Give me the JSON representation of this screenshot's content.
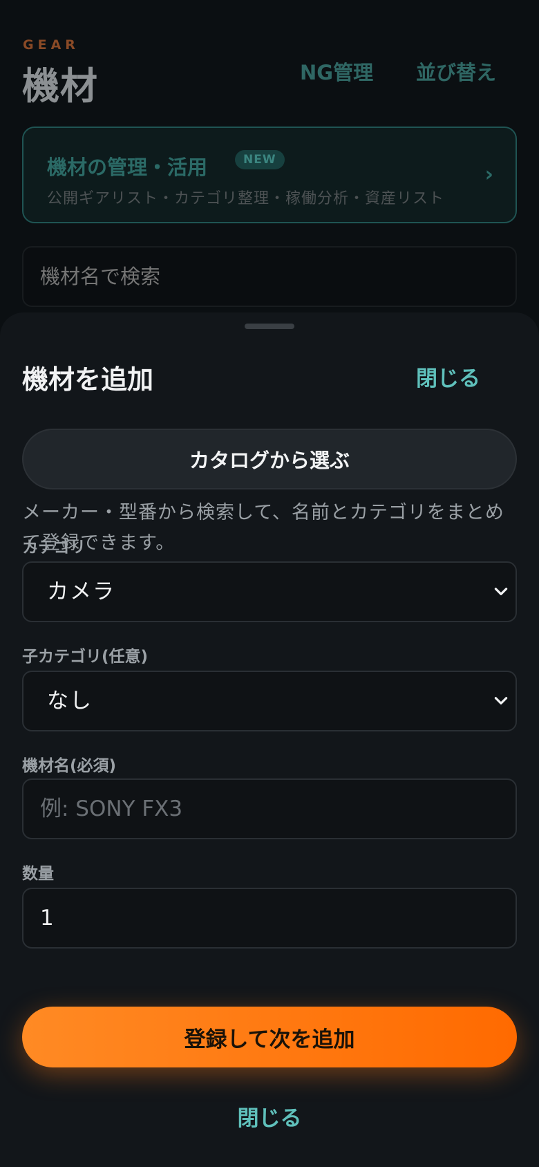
{
  "background": {
    "header": {
      "kicker": "GEAR",
      "title": "機材",
      "ng_label": "NG管理",
      "sort_label": "並び替え"
    },
    "promo": {
      "title": "機材の管理・活用",
      "badge": "NEW",
      "subtitle": "公開ギアリスト・カテゴリ整理・稼働分析・資産リスト",
      "chevron": "›"
    },
    "search": {
      "placeholder": "機材名で検索"
    }
  },
  "sheet": {
    "title": "機材を追加",
    "close_top_label": "閉じる",
    "catalog_button_label": "カタログから選ぶ",
    "catalog_help": "メーカー・型番から検索して、名前とカテゴリをまとめて登録できます。",
    "fields": {
      "category": {
        "label": "カテゴリ",
        "value": "カメラ"
      },
      "subcategory": {
        "label": "子カテゴリ(任意)",
        "value": "なし"
      },
      "name": {
        "label": "機材名(必須)",
        "placeholder": "例: SONY FX3"
      },
      "quantity": {
        "label": "数量",
        "value": "1"
      }
    },
    "submit_label": "登録して次を追加",
    "close_bottom_label": "閉じる"
  },
  "icons": {
    "select_chevron": "chevron-down-icon",
    "promo_chevron": "chevron-right-icon"
  },
  "colors": {
    "accent_orange": "#ff7a10",
    "accent_teal": "#5fc0bb",
    "sheet_bg": "#12161a"
  }
}
